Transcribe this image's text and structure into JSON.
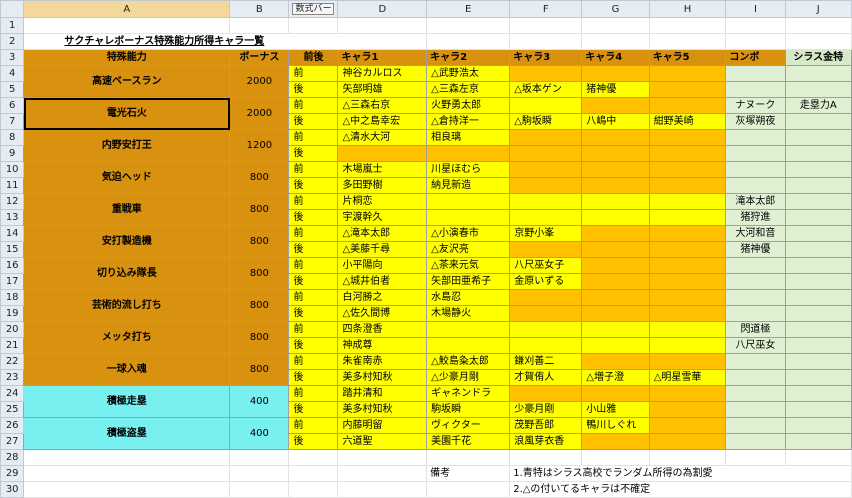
{
  "columns": [
    "A",
    "B",
    "C",
    "D",
    "E",
    "F",
    "G",
    "H",
    "I",
    "J"
  ],
  "selected_column": "A",
  "tooltip": "数式バー",
  "title": "サクチャレボーナス特殊能力所得キャラ一覧",
  "headers": {
    "skill": "特殊能力",
    "bonus": "ボーナス",
    "zengo": "前後",
    "c1": "キャラ1",
    "c2": "キャラ2",
    "c3": "キャラ3",
    "c4": "キャラ4",
    "c5": "キャラ5",
    "combo": "コンボ",
    "shirasu": "シラス金特"
  },
  "row_numbers": [
    "1",
    "2",
    "3",
    "4",
    "5",
    "6",
    "7",
    "8",
    "9",
    "10",
    "11",
    "12",
    "13",
    "14",
    "15",
    "16",
    "17",
    "18",
    "19",
    "20",
    "21",
    "22",
    "23",
    "24",
    "25",
    "26",
    "27",
    "28",
    "29",
    "30"
  ],
  "groups": [
    {
      "skill": "高速ベースラン",
      "bonus": "2000",
      "cyan": false,
      "rows": [
        {
          "zengo": "前",
          "cells": [
            "神谷カルロス",
            "△武野浩太",
            "",
            "",
            ""
          ],
          "fill": [
            "y",
            "y",
            "o",
            "o",
            "o"
          ]
        },
        {
          "zengo": "後",
          "cells": [
            "矢部明雄",
            "△三森左京",
            "△坂本ゲン",
            "猪神優",
            ""
          ],
          "fill": [
            "y",
            "y",
            "y",
            "y",
            "o"
          ]
        }
      ],
      "combo": [
        "",
        ""
      ],
      "shirasu": [
        "",
        ""
      ]
    },
    {
      "skill": "電光石火",
      "bonus": "2000",
      "cyan": false,
      "selected": true,
      "rows": [
        {
          "zengo": "前",
          "cells": [
            "△三森右京",
            "火野勇太郎",
            "",
            "",
            ""
          ],
          "fill": [
            "y",
            "y",
            "y",
            "o",
            "o"
          ]
        },
        {
          "zengo": "後",
          "cells": [
            "△中之島幸宏",
            "△倉持洋一",
            "△駒坂瞬",
            "八嶋中",
            "紺野美崎"
          ],
          "fill": [
            "y",
            "y",
            "y",
            "y",
            "y"
          ]
        }
      ],
      "combo": [
        "ナヌーク",
        "灰塚朔夜"
      ],
      "shirasu": [
        "走塁力A",
        ""
      ]
    },
    {
      "skill": "内野安打王",
      "bonus": "1200",
      "cyan": false,
      "rows": [
        {
          "zengo": "前",
          "cells": [
            "△清水大河",
            "相良璃",
            "",
            "",
            ""
          ],
          "fill": [
            "y",
            "y",
            "o",
            "o",
            "o"
          ]
        },
        {
          "zengo": "後",
          "cells": [
            "",
            "",
            "",
            "",
            ""
          ],
          "fill": [
            "o",
            "o",
            "o",
            "o",
            "o"
          ]
        }
      ],
      "combo": [
        "",
        ""
      ],
      "shirasu": [
        "",
        ""
      ]
    },
    {
      "skill": "気迫ヘッド",
      "bonus": "800",
      "cyan": false,
      "rows": [
        {
          "zengo": "前",
          "cells": [
            "木場嵐士",
            "川星ほむら",
            "",
            "",
            ""
          ],
          "fill": [
            "y",
            "y",
            "o",
            "o",
            "o"
          ]
        },
        {
          "zengo": "後",
          "cells": [
            "多田野樹",
            "納見新造",
            "",
            "",
            ""
          ],
          "fill": [
            "y",
            "y",
            "o",
            "o",
            "o"
          ]
        }
      ],
      "combo": [
        "",
        ""
      ],
      "shirasu": [
        "",
        ""
      ]
    },
    {
      "skill": "重戦車",
      "bonus": "800",
      "cyan": false,
      "rows": [
        {
          "zengo": "前",
          "cells": [
            "片桐恋",
            "",
            "",
            "",
            ""
          ],
          "fill": [
            "y",
            "y",
            "y",
            "y",
            "y"
          ]
        },
        {
          "zengo": "後",
          "cells": [
            "宇渡幹久",
            "",
            "",
            "",
            ""
          ],
          "fill": [
            "y",
            "y",
            "y",
            "y",
            "y"
          ]
        }
      ],
      "combo": [
        "滝本太郎",
        "猪狩進"
      ],
      "shirasu": [
        "",
        ""
      ]
    },
    {
      "skill": "安打製造機",
      "bonus": "800",
      "cyan": false,
      "rows": [
        {
          "zengo": "前",
          "cells": [
            "△滝本太郎",
            "△小演春市",
            "京野小峯",
            "",
            ""
          ],
          "fill": [
            "y",
            "y",
            "y",
            "o",
            "o"
          ]
        },
        {
          "zengo": "後",
          "cells": [
            "△美藤千尋",
            "△友沢亮",
            "",
            "",
            ""
          ],
          "fill": [
            "y",
            "y",
            "o",
            "o",
            "o"
          ]
        }
      ],
      "combo": [
        "大河和音",
        "猪神優"
      ],
      "shirasu": [
        "",
        ""
      ]
    },
    {
      "skill": "切り込み隊長",
      "bonus": "800",
      "cyan": false,
      "rows": [
        {
          "zengo": "前",
          "cells": [
            "小平陽向",
            "△茶来元気",
            "八尺巫女子",
            "",
            ""
          ],
          "fill": [
            "y",
            "y",
            "y",
            "o",
            "o"
          ]
        },
        {
          "zengo": "後",
          "cells": [
            "△城井伯者",
            "矢部田亜希子",
            "金原いずる",
            "",
            ""
          ],
          "fill": [
            "y",
            "y",
            "y",
            "o",
            "o"
          ]
        }
      ],
      "combo": [
        "",
        ""
      ],
      "shirasu": [
        "",
        ""
      ]
    },
    {
      "skill": "芸術的流し打ち",
      "bonus": "800",
      "cyan": false,
      "rows": [
        {
          "zengo": "前",
          "cells": [
            "白河勝之",
            "水島忍",
            "",
            "",
            ""
          ],
          "fill": [
            "y",
            "y",
            "o",
            "o",
            "o"
          ]
        },
        {
          "zengo": "後",
          "cells": [
            "△佐久間博",
            "木場静火",
            "",
            "",
            ""
          ],
          "fill": [
            "y",
            "y",
            "o",
            "o",
            "o"
          ]
        }
      ],
      "combo": [
        "",
        ""
      ],
      "shirasu": [
        "",
        ""
      ]
    },
    {
      "skill": "メッタ打ち",
      "bonus": "800",
      "cyan": false,
      "rows": [
        {
          "zengo": "前",
          "cells": [
            "四条澄香",
            "",
            "",
            "",
            ""
          ],
          "fill": [
            "y",
            "y",
            "y",
            "y",
            "y"
          ]
        },
        {
          "zengo": "後",
          "cells": [
            "神成尊",
            "",
            "",
            "",
            ""
          ],
          "fill": [
            "y",
            "y",
            "y",
            "y",
            "y"
          ]
        }
      ],
      "combo": [
        "閃道極",
        "八尺巫女"
      ],
      "shirasu": [
        "",
        ""
      ]
    },
    {
      "skill": "一球入魂",
      "bonus": "800",
      "cyan": false,
      "rows": [
        {
          "zengo": "前",
          "cells": [
            "朱雀南赤",
            "△鮫島粂太郎",
            "鎌刈善二",
            "",
            ""
          ],
          "fill": [
            "y",
            "y",
            "y",
            "o",
            "o"
          ]
        },
        {
          "zengo": "後",
          "cells": [
            "美多村知秋",
            "△少豪月剛",
            "才賀侑人",
            "△増子澄",
            "△明星雪華"
          ],
          "fill": [
            "y",
            "y",
            "y",
            "y",
            "y"
          ]
        }
      ],
      "combo": [
        "",
        ""
      ],
      "shirasu": [
        "",
        ""
      ]
    },
    {
      "skill": "積極走塁",
      "bonus": "400",
      "cyan": true,
      "rows": [
        {
          "zengo": "前",
          "cells": [
            "踏井清和",
            "ギャネンドラ",
            "",
            "",
            ""
          ],
          "fill": [
            "y",
            "y",
            "o",
            "o",
            "o"
          ]
        },
        {
          "zengo": "後",
          "cells": [
            "美多村知秋",
            "駒坂瞬",
            "少豪月剛",
            "小山雅",
            ""
          ],
          "fill": [
            "y",
            "y",
            "y",
            "y",
            "o"
          ]
        }
      ],
      "combo": [
        "",
        ""
      ],
      "shirasu": [
        "",
        ""
      ]
    },
    {
      "skill": "積極盗塁",
      "bonus": "400",
      "cyan": true,
      "rows": [
        {
          "zengo": "前",
          "cells": [
            "内藤明留",
            "ヴィクター",
            "茂野吾郎",
            "鴨川しぐれ",
            ""
          ],
          "fill": [
            "y",
            "y",
            "y",
            "y",
            "o"
          ]
        },
        {
          "zengo": "後",
          "cells": [
            "六道聖",
            "美園千花",
            "浪風芽衣香",
            "",
            ""
          ],
          "fill": [
            "y",
            "y",
            "y",
            "o",
            "o"
          ]
        }
      ],
      "combo": [
        "",
        ""
      ],
      "shirasu": [
        "",
        ""
      ]
    }
  ],
  "notes": {
    "label": "備考",
    "line1": "1.青特はシラス高校でランダム所得の為割愛",
    "line2": "2.△の付いてるキャラは不確定"
  }
}
